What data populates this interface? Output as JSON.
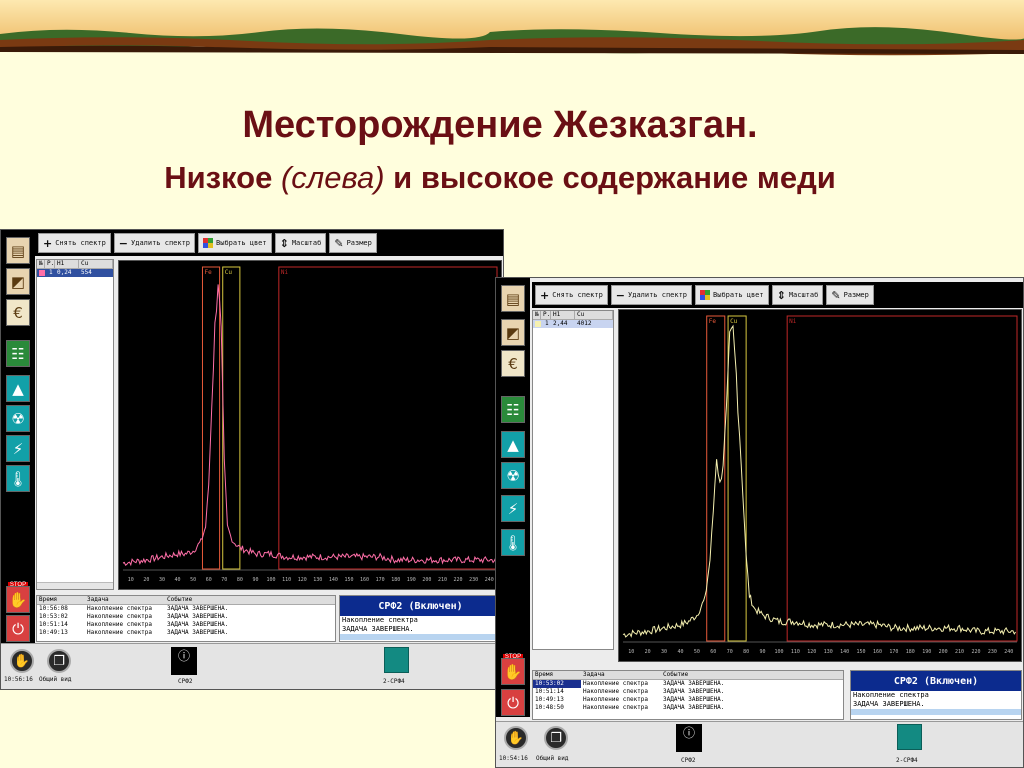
{
  "slide": {
    "title": "Месторождение Жезказган.",
    "subtitle_before": "Низкое ",
    "subtitle_italic": "(слева)",
    "subtitle_after": " и высокое содержание меди"
  },
  "toolbar": {
    "take_spectrum": "Снять спектр",
    "delete_spectrum": "Удалить спектр",
    "choose_color": "Выбрать цвет",
    "scale": "Масштаб",
    "size": "Размер"
  },
  "table_headers": [
    "№",
    "Р.",
    "Н1",
    "Cu"
  ],
  "log_headers": [
    "Время",
    "Задача",
    "Событие"
  ],
  "status_title": "СРФ2 (Включен)",
  "status_lines": [
    "Накопление спектра",
    "ЗАДАЧА ЗАВЕРШЕНА."
  ],
  "stop_label": "STOP",
  "taskbar": {
    "overview": "Общий вид",
    "device1": "СРФ2",
    "device2": "2-СРФ4"
  },
  "roi_labels": {
    "fe": "Fe",
    "cu": "Cu",
    "ni": "Ni"
  },
  "x_ticks": [
    "10",
    "20",
    "30",
    "40",
    "50",
    "60",
    "70",
    "80",
    "90",
    "100",
    "110",
    "120",
    "130",
    "140",
    "150",
    "160",
    "170",
    "180",
    "190",
    "200",
    "210",
    "220",
    "230",
    "240"
  ],
  "left": {
    "row": {
      "num": "1",
      "p": "0,24",
      "cu": "554"
    },
    "swatch_color": "#ff6fa8",
    "log_rows": [
      {
        "time": "10:56:08",
        "task": "Накопление спектра",
        "event": "ЗАДАЧА ЗАВЕРШЕНА."
      },
      {
        "time": "10:53:02",
        "task": "Накопление спектра",
        "event": "ЗАДАЧА ЗАВЕРШЕНА."
      },
      {
        "time": "10:51:14",
        "task": "Накопление спектра",
        "event": "ЗАДАЧА ЗАВЕРШЕНА."
      },
      {
        "time": "10:49:13",
        "task": "Накопление спектра",
        "event": "ЗАДАЧА ЗАВЕРШЕНА."
      }
    ],
    "clock": "10:56:16"
  },
  "right": {
    "row": {
      "num": "1",
      "p": "2,44",
      "cu": "4012"
    },
    "swatch_color": "#f5f0b0",
    "log_rows": [
      {
        "time": "10:53:02",
        "task": "Накопление спектра",
        "event": "ЗАДАЧА ЗАВЕРШЕНА."
      },
      {
        "time": "10:51:14",
        "task": "Накопление спектра",
        "event": "ЗАДАЧА ЗАВЕРШЕНА."
      },
      {
        "time": "10:49:13",
        "task": "Накопление спектра",
        "event": "ЗАДАЧА ЗАВЕРШЕНА."
      },
      {
        "time": "10:48:50",
        "task": "Накопление спектра",
        "event": "ЗАДАЧА ЗАВЕРШЕНА."
      }
    ],
    "clock": "10:54:16"
  },
  "chart_data": [
    {
      "type": "line",
      "xlim": [
        10,
        245
      ],
      "ylim": [
        0,
        100
      ],
      "grid": false,
      "color": "#ff6fa8",
      "x": [
        5,
        20,
        30,
        40,
        45,
        50,
        55,
        58,
        60,
        62,
        64,
        66,
        68,
        70,
        72,
        74,
        76,
        80,
        85,
        90,
        95,
        100,
        110,
        120,
        130,
        140,
        150,
        160,
        170,
        180,
        190,
        200,
        210,
        220,
        230,
        240,
        245
      ],
      "y": [
        2,
        3,
        4,
        5,
        5,
        6,
        9,
        14,
        28,
        55,
        80,
        96,
        78,
        35,
        14,
        11,
        9,
        7,
        6,
        5,
        5,
        5,
        4,
        4,
        4,
        4,
        4,
        4,
        4,
        3,
        3,
        3,
        3,
        3,
        3,
        3,
        3
      ]
    },
    {
      "type": "line",
      "xlim": [
        10,
        245
      ],
      "ylim": [
        0,
        100
      ],
      "grid": false,
      "color": "#f5f0b0",
      "x": [
        5,
        20,
        30,
        40,
        45,
        50,
        55,
        58,
        60,
        62,
        64,
        66,
        68,
        70,
        72,
        74,
        76,
        78,
        80,
        82,
        85,
        90,
        95,
        100,
        110,
        120,
        130,
        140,
        150,
        160,
        170,
        180,
        190,
        200,
        210,
        220,
        230,
        240,
        245
      ],
      "y": [
        2,
        3,
        4,
        5,
        6,
        8,
        13,
        25,
        40,
        57,
        48,
        55,
        70,
        92,
        95,
        82,
        64,
        46,
        26,
        14,
        10,
        8,
        7,
        6,
        6,
        5,
        5,
        5,
        5,
        5,
        4,
        4,
        4,
        4,
        4,
        3,
        3,
        3,
        3
      ]
    }
  ]
}
